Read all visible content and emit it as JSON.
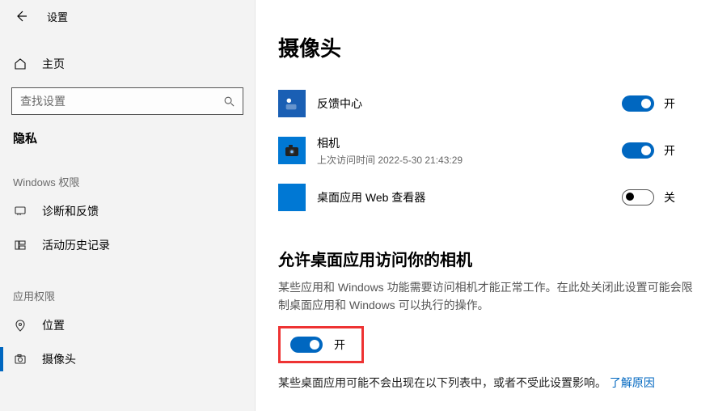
{
  "titlebar": {
    "title": "设置"
  },
  "sidebar": {
    "home_label": "主页",
    "search_placeholder": "查找设置",
    "category_label": "隐私",
    "group1_label": "Windows 权限",
    "group2_label": "应用权限",
    "items": {
      "diagnostics": "诊断和反馈",
      "activity": "活动历史记录",
      "location": "位置",
      "camera": "摄像头"
    }
  },
  "main": {
    "page_title": "摄像头",
    "apps": [
      {
        "name": "反馈中心",
        "sub": "",
        "toggle_on": true,
        "toggle_label": "开",
        "icon": "feedback"
      },
      {
        "name": "相机",
        "sub": "上次访问时间 2022-5-30 21:43:29",
        "toggle_on": true,
        "toggle_label": "开",
        "icon": "camera"
      },
      {
        "name": "桌面应用 Web 查看器",
        "sub": "",
        "toggle_on": false,
        "toggle_label": "关",
        "icon": "blank"
      }
    ],
    "section2_title": "允许桌面应用访问你的相机",
    "section2_desc": "某些应用和 Windows 功能需要访问相机才能正常工作。在此处关闭此设置可能会限制桌面应用和 Windows 可以执行的操作。",
    "desktop_toggle_on": true,
    "desktop_toggle_label": "开",
    "note_text": "某些桌面应用可能不会出现在以下列表中，或者不受此设置影响。 ",
    "note_link": "了解原因"
  }
}
